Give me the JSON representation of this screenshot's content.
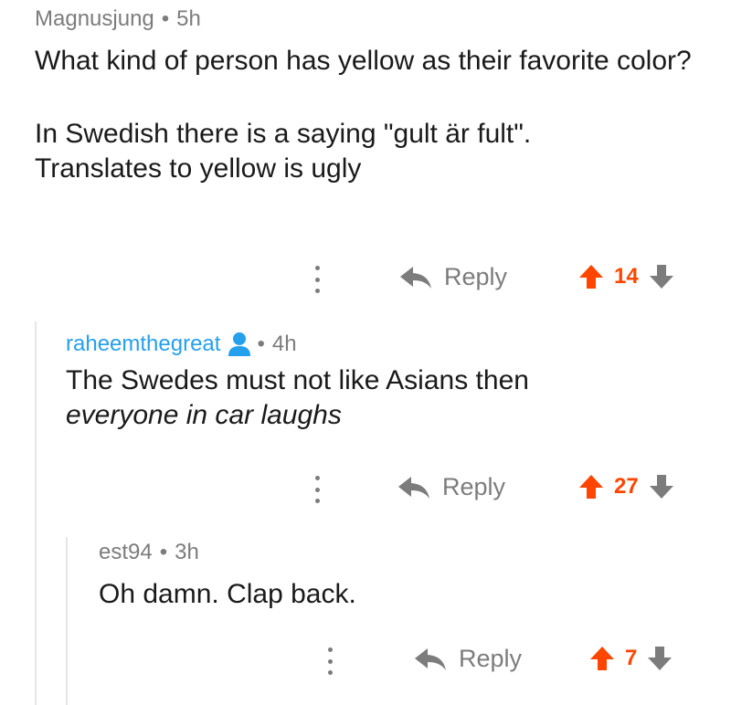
{
  "comments": [
    {
      "author": "Magnusjung",
      "time": "5h",
      "paragraphs": [
        "What kind of person has yellow as their favorite color?",
        "In Swedish there is a saying \"gult är fult\". Translates to yellow is ugly"
      ],
      "reply_label": "Reply",
      "score": "14"
    },
    {
      "author": "raheemthegreat",
      "time": "4h",
      "line1": "The Swedes must not like Asians then",
      "line2": "everyone in car laughs",
      "reply_label": "Reply",
      "score": "27"
    },
    {
      "author": "est94",
      "time": "3h",
      "line1": "Oh damn. Clap back.",
      "reply_label": "Reply",
      "score": "7"
    }
  ],
  "colors": {
    "upvote": "#ff4500",
    "downvote": "#7c7c7c",
    "link": "#24a0ed",
    "meta": "#7c7c7c",
    "thread_line": "#e6e6e6"
  },
  "icons": {
    "more": "more-vertical-icon",
    "reply": "reply-arrow-icon",
    "upvote": "upvote-arrow-icon",
    "downvote": "downvote-arrow-icon",
    "op_badge": "user-icon"
  }
}
